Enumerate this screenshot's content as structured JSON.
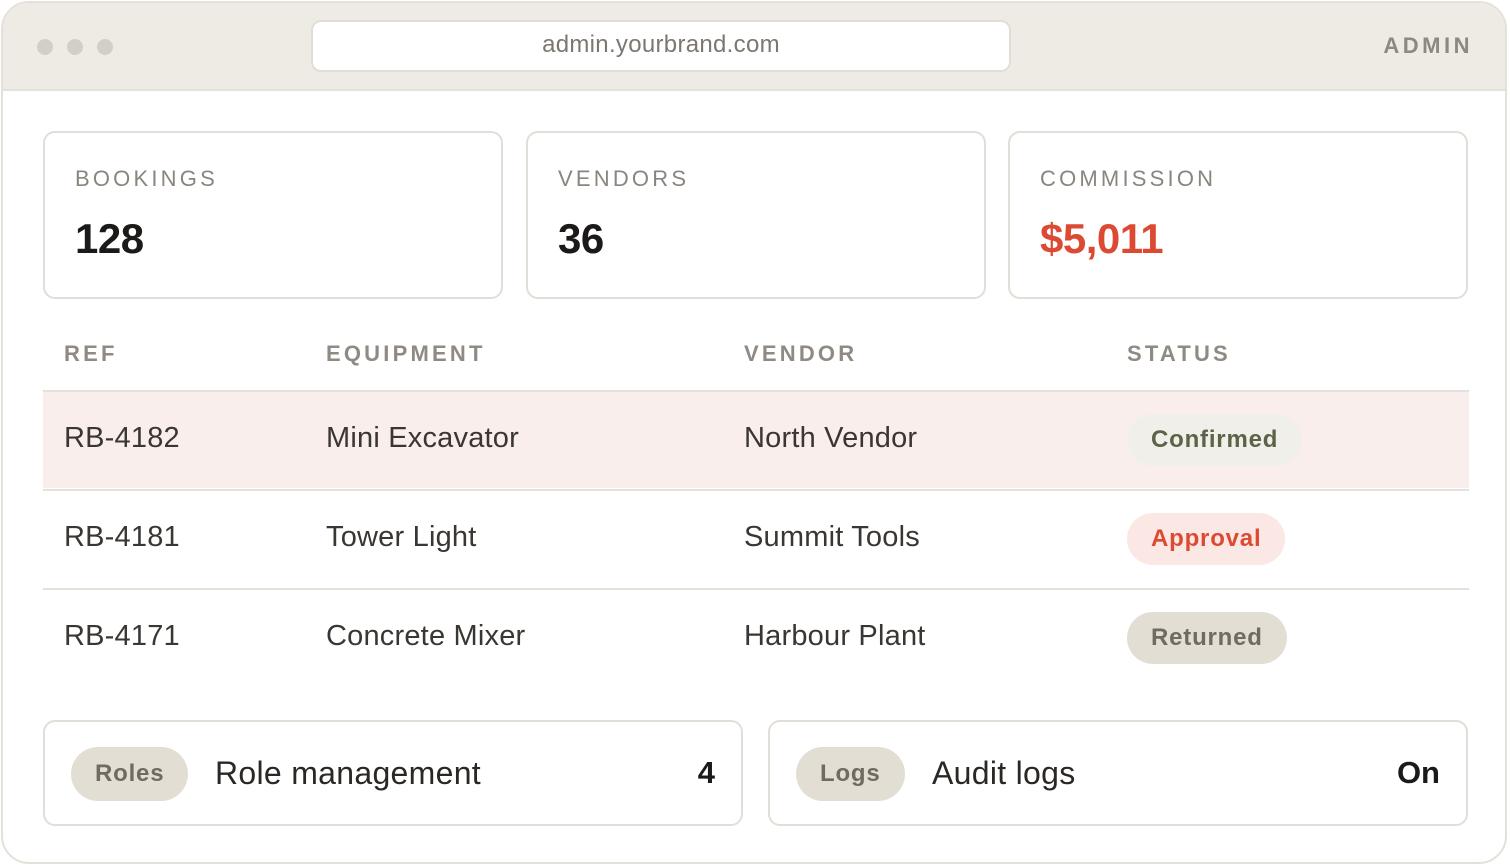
{
  "browser": {
    "url": "admin.yourbrand.com",
    "badge": "ADMIN"
  },
  "stats": [
    {
      "label": "BOOKINGS",
      "value": "128"
    },
    {
      "label": "VENDORS",
      "value": "36"
    },
    {
      "label": "COMMISSION",
      "value": "$5,011"
    }
  ],
  "table": {
    "headers": [
      "REF",
      "EQUIPMENT",
      "VENDOR",
      "STATUS"
    ],
    "rows": [
      {
        "ref": "RB-4182",
        "equipment": "Mini Excavator",
        "vendor": "North Vendor",
        "status": "Confirmed"
      },
      {
        "ref": "RB-4181",
        "equipment": "Tower Light",
        "vendor": "Summit Tools",
        "status": "Approval"
      },
      {
        "ref": "RB-4171",
        "equipment": "Concrete Mixer",
        "vendor": "Harbour Plant",
        "status": "Returned"
      }
    ]
  },
  "settings": [
    {
      "tag": "Roles",
      "title": "Role management",
      "value": "4"
    },
    {
      "tag": "Logs",
      "title": "Audit logs",
      "value": "On"
    }
  ],
  "colors": {
    "accent": "#dd4a33",
    "highlight_row": "#faeeec",
    "confirmed_text": "#5b6448",
    "chrome_bg": "#eeebe5"
  }
}
